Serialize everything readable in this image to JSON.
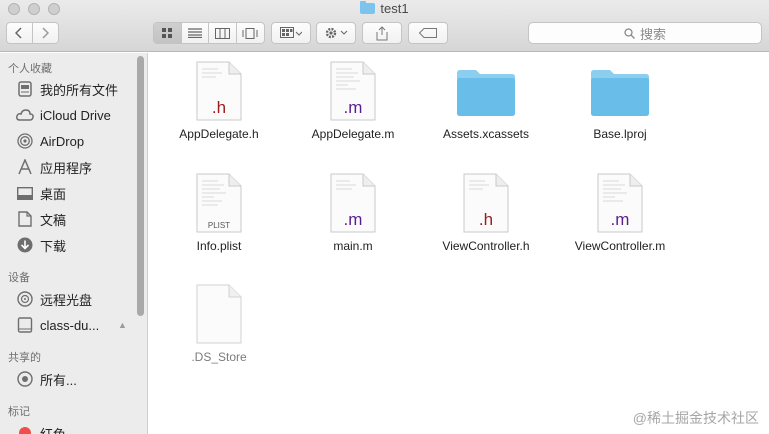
{
  "window": {
    "title": "test1"
  },
  "toolbar": {
    "back_icon": "chevron-left-icon",
    "forward_icon": "chevron-right-icon",
    "view_icons": [
      "grid-view-icon",
      "list-view-icon",
      "column-view-icon",
      "coverflow-view-icon"
    ],
    "arrange_icon": "arrange-icon",
    "action_icon": "gear-icon",
    "share_icon": "share-icon",
    "tag_icon": "tag-icon"
  },
  "search": {
    "placeholder": "搜索"
  },
  "sidebar": {
    "sections": [
      {
        "title": "个人收藏",
        "items": [
          {
            "label": "我的所有文件",
            "icon": "all-files-icon"
          },
          {
            "label": "iCloud Drive",
            "icon": "cloud-icon"
          },
          {
            "label": "AirDrop",
            "icon": "airdrop-icon"
          },
          {
            "label": "应用程序",
            "icon": "applications-icon"
          },
          {
            "label": "桌面",
            "icon": "desktop-icon"
          },
          {
            "label": "文稿",
            "icon": "documents-icon"
          },
          {
            "label": "下载",
            "icon": "download-icon"
          }
        ]
      },
      {
        "title": "设备",
        "items": [
          {
            "label": "远程光盘",
            "icon": "disc-icon"
          },
          {
            "label": "class-du...",
            "icon": "disk-icon"
          }
        ]
      },
      {
        "title": "共享的",
        "items": [
          {
            "label": "所有...",
            "icon": "network-icon"
          }
        ]
      },
      {
        "title": "标记",
        "items": [
          {
            "label": "红色",
            "icon": "red-tag-icon"
          }
        ]
      }
    ]
  },
  "files": [
    {
      "name": "AppDelegate.h",
      "kind": "doc",
      "ext": ".h",
      "ext_color": "#9b1c1c"
    },
    {
      "name": "AppDelegate.m",
      "kind": "doc",
      "ext": ".m",
      "ext_color": "#5a1f8c"
    },
    {
      "name": "Assets.xcassets",
      "kind": "folder"
    },
    {
      "name": "Base.lproj",
      "kind": "folder"
    },
    {
      "name": "Info.plist",
      "kind": "doc",
      "ext": "PLIST",
      "ext_color": "#555555"
    },
    {
      "name": "main.m",
      "kind": "doc",
      "ext": ".m",
      "ext_color": "#5a1f8c"
    },
    {
      "name": "ViewController.h",
      "kind": "doc",
      "ext": ".h",
      "ext_color": "#9b1c1c"
    },
    {
      "name": "ViewController.m",
      "kind": "doc",
      "ext": ".m",
      "ext_color": "#5a1f8c"
    },
    {
      "name": ".DS_Store",
      "kind": "blank"
    }
  ],
  "colors": {
    "folder": "#68bde9",
    "folder_tab": "#8ccef0",
    "red_tag": "#ef4f4a"
  },
  "watermark": "@稀土掘金技术社区"
}
